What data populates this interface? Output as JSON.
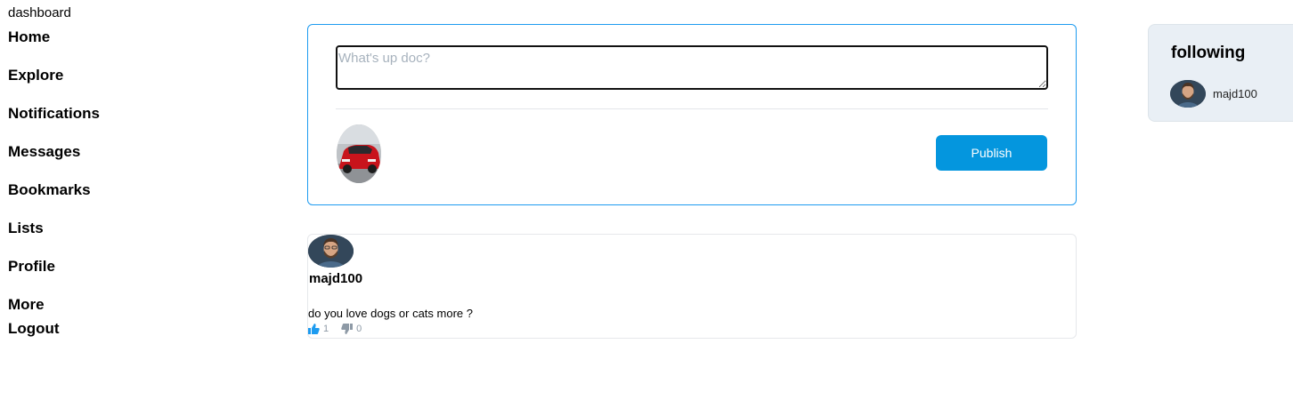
{
  "sidebar": {
    "dashboard_label": "dashboard",
    "items": [
      {
        "label": "Home"
      },
      {
        "label": "Explore"
      },
      {
        "label": "Notifications"
      },
      {
        "label": "Messages"
      },
      {
        "label": "Bookmarks"
      },
      {
        "label": "Lists"
      },
      {
        "label": "Profile"
      },
      {
        "label": "More"
      },
      {
        "label": "Logout"
      }
    ]
  },
  "composer": {
    "placeholder": "What's up doc?",
    "value": "",
    "publish_label": "Publish"
  },
  "post": {
    "author": "majd100",
    "text": "do you love dogs or cats more ?",
    "likes": "1",
    "dislikes": "0"
  },
  "following": {
    "title": "following",
    "users": [
      {
        "name": "majd100"
      }
    ]
  },
  "colors": {
    "accent": "#0496de",
    "border_accent": "#1d9bf0",
    "panel_bg": "#e9eff5"
  }
}
